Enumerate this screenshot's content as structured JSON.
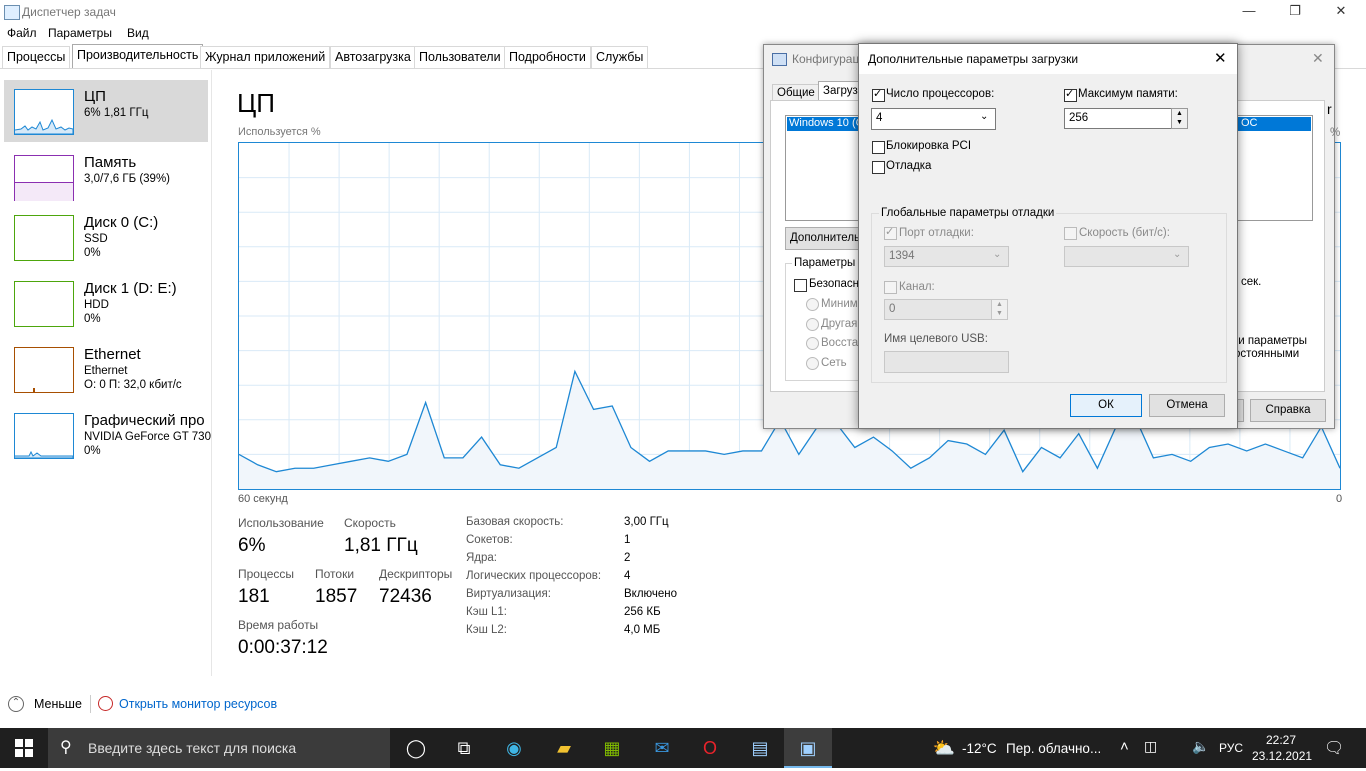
{
  "window": {
    "title": "Диспетчер задач"
  },
  "menu": [
    "Файл",
    "Параметры",
    "Вид"
  ],
  "tabs": [
    "Процессы",
    "Производительность",
    "Журнал приложений",
    "Автозагрузка",
    "Пользователи",
    "Подробности",
    "Службы"
  ],
  "sidebar": [
    {
      "name": "ЦП",
      "sub1": "6% 1,81 ГГц",
      "sub2": ""
    },
    {
      "name": "Память",
      "sub1": "3,0/7,6 ГБ (39%)",
      "sub2": ""
    },
    {
      "name": "Диск 0 (C:)",
      "sub1": "SSD",
      "sub2": "0%"
    },
    {
      "name": "Диск 1 (D: E:)",
      "sub1": "HDD",
      "sub2": "0%"
    },
    {
      "name": "Ethernet",
      "sub1": "Ethernet",
      "sub2": "О: 0 П: 32,0 кбит/с"
    },
    {
      "name": "Графический про",
      "sub1": "NVIDIA GeForce GT 730",
      "sub2": "0%"
    }
  ],
  "main": {
    "title": "ЦП",
    "graph_label": "Используется %",
    "axis_left": "60 секунд",
    "axis_right": "0",
    "stats": {
      "usage_label": "Использование",
      "usage_value": "6%",
      "speed_label": "Скорость",
      "speed_value": "1,81 ГГц",
      "processes_label": "Процессы",
      "processes_value": "181",
      "threads_label": "Потоки",
      "threads_value": "1857",
      "handles_label": "Дескрипторы",
      "handles_value": "72436",
      "uptime_label": "Время работы",
      "uptime_value": "0:00:37:12"
    },
    "info": [
      {
        "label": "Базовая скорость:",
        "value": "3,00 ГГц"
      },
      {
        "label": "Сокетов:",
        "value": "1"
      },
      {
        "label": "Ядра:",
        "value": "2"
      },
      {
        "label": "Логических процессоров:",
        "value": "4"
      },
      {
        "label": "Виртуализация:",
        "value": "Включено"
      },
      {
        "label": "Кэш L1:",
        "value": "256 КБ"
      },
      {
        "label": "Кэш L2:",
        "value": "4,0 МБ"
      }
    ]
  },
  "chart_data": {
    "type": "area",
    "title": "",
    "ylabel": "Используется %",
    "xlabel": "",
    "ylim": [
      0,
      100
    ],
    "values": [
      10,
      7,
      5,
      6,
      6,
      7,
      8,
      9,
      8,
      10,
      25,
      9,
      9,
      15,
      7,
      6,
      9,
      12,
      34,
      23,
      24,
      12,
      8,
      11,
      11,
      11,
      10,
      11,
      11,
      20,
      10,
      18,
      19,
      12,
      15,
      11,
      6,
      9,
      14,
      13,
      10,
      17,
      5,
      12,
      9,
      16,
      6,
      18,
      21,
      9,
      10,
      8,
      12,
      13,
      11,
      13,
      11,
      9,
      18,
      6
    ]
  },
  "bottom": {
    "less": "Меньше",
    "resmon": "Открыть монитор ресурсов"
  },
  "cfg_dialog": {
    "title": "Конфигурац",
    "tab_general": "Общие",
    "tab_boot": "Загруз",
    "os_entry": "Windows 10 (C",
    "os_entry_right": "ОС",
    "advanced_btn": "Дополнитель",
    "boot_params": "Параметры з",
    "safe_boot": "Безопасн",
    "minimal": "Минима",
    "other": "Другая",
    "restore": "Восстан",
    "network": "Сеть",
    "sec": "сек.",
    "params1": "ги параметры",
    "params2": "остоянными",
    "help_btn": "Справка",
    "right_r": "r",
    "right_pct": "%"
  },
  "adv_dialog": {
    "title": "Дополнительные параметры загрузки",
    "num_proc_label": "Число процессоров:",
    "num_proc_value": "4",
    "max_mem_label": "Максимум памяти:",
    "max_mem_value": "256",
    "pci_lock": "Блокировка PCI",
    "debug": "Отладка",
    "global_debug": "Глобальные параметры отладки",
    "debug_port": "Порт отладки:",
    "debug_port_value": "1394",
    "baud_rate": "Скорость (бит/с):",
    "channel": "Канал:",
    "channel_value": "0",
    "usb_target": "Имя целевого USB:",
    "ok": "ОК",
    "cancel": "Отмена"
  },
  "taskbar": {
    "search_placeholder": "Введите здесь текст для поиска",
    "weather_temp": "-12°C",
    "weather_desc": "Пер. облачно...",
    "lang": "РУС",
    "time": "22:27",
    "date": "23.12.2021"
  }
}
